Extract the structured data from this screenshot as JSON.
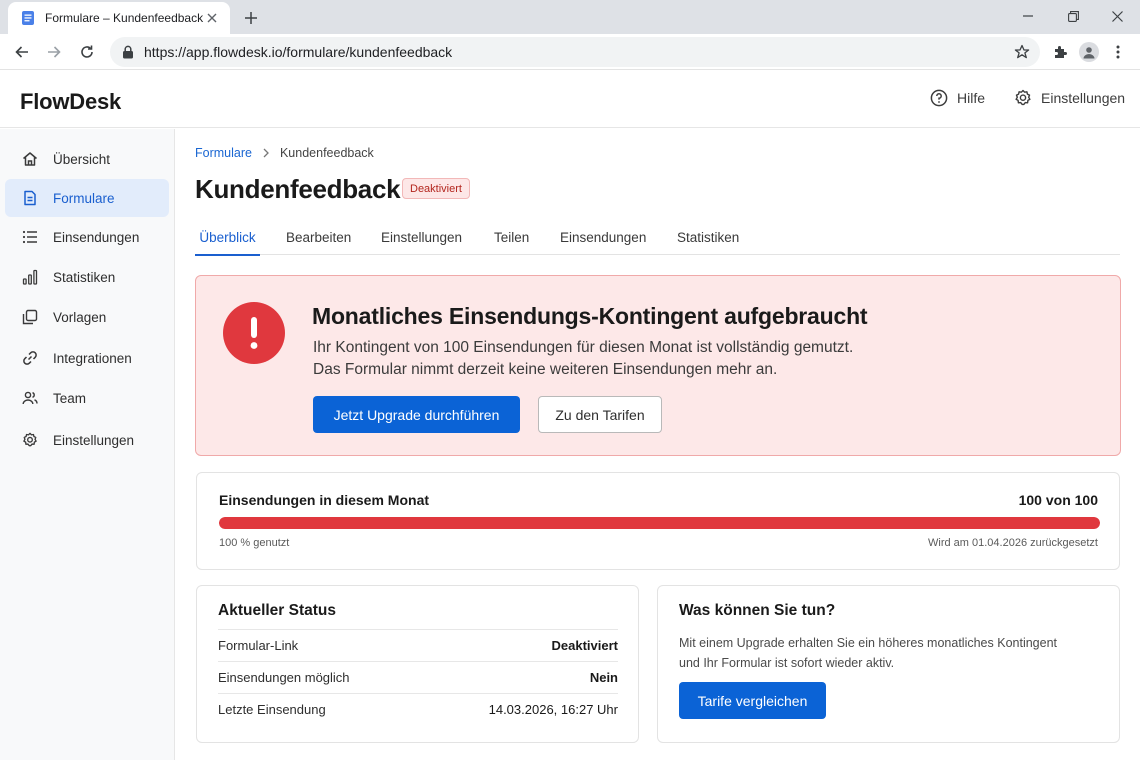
{
  "browser": {
    "tab_title": "Formulare – Kundenfeedback",
    "url": "https://app.flowdesk.io/formulare/kundenfeedback"
  },
  "header": {
    "logo": "FlowDesk",
    "help_label": "Hilfe",
    "settings_label": "Einstellungen"
  },
  "sidebar": {
    "items": [
      {
        "label": "Übersicht",
        "icon": "home-icon"
      },
      {
        "label": "Formulare",
        "icon": "document-icon",
        "active": true
      },
      {
        "label": "Einsendungen",
        "icon": "list-icon"
      },
      {
        "label": "Statistiken",
        "icon": "bar-chart-icon"
      },
      {
        "label": "Vorlagen",
        "icon": "templates-icon"
      },
      {
        "label": "Integrationen",
        "icon": "link-icon"
      },
      {
        "label": "Team",
        "icon": "users-icon"
      },
      {
        "label": "Einstellungen",
        "icon": "gear-icon"
      }
    ]
  },
  "breadcrumb": {
    "parent": "Formulare",
    "current": "Kundenfeedback"
  },
  "page": {
    "title": "Kundenfeedback",
    "status_badge": "Deaktiviert"
  },
  "tabs": [
    "Überblick",
    "Bearbeiten",
    "Einstellungen",
    "Teilen",
    "Einsendungen",
    "Statistiken"
  ],
  "alert": {
    "title": "Monatliches Einsendungs-Kontingent aufgebraucht",
    "line1": "Ihr Kontingent von 100 Einsendungen für diesen Monat ist vollständig gemutzt.",
    "line2": "Das Formular nimmt derzeit keine weiteren Einsendungen mehr an.",
    "primary_button": "Jetzt Upgrade durchführen",
    "secondary_button": "Zu den Tarifen"
  },
  "usage": {
    "title": "Einsendungen in diesem Monat",
    "count": "100 von 100",
    "used_fraction": 1.0,
    "percent_label": "100 % genutzt",
    "reset_label": "Wird am 01.04.2026 zurückgesetzt"
  },
  "status_card": {
    "title": "Aktueller Status",
    "rows": [
      {
        "label": "Formular-Link",
        "value": "Deaktiviert"
      },
      {
        "label": "Einsendungen möglich",
        "value": "Nein"
      },
      {
        "label": "Letzte Einsendung",
        "value": "14.03.2026, 16:27 Uhr"
      }
    ]
  },
  "actions_card": {
    "title": "Was können Sie tun?",
    "text": "Mit einem Upgrade erhalten Sie ein höheres monatliches Kontingent und Ihr Formular ist sofort wieder aktiv.",
    "button": "Tarife vergleichen"
  },
  "colors": {
    "accent": "#0b63d6",
    "danger": "#e0383e",
    "alert_bg": "#fde8e8"
  }
}
